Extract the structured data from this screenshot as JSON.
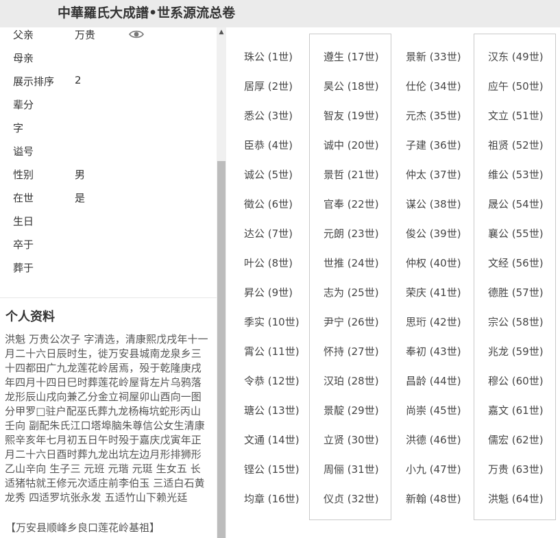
{
  "header": {
    "title": "中華羅氏大成譜•世系源流总卷"
  },
  "fields": [
    {
      "label": "父亲",
      "value": "万贵"
    },
    {
      "label": "母亲",
      "value": ""
    },
    {
      "label": "展示排序",
      "value": "2"
    },
    {
      "label": "辈分",
      "value": ""
    },
    {
      "label": "字",
      "value": ""
    },
    {
      "label": "谥号",
      "value": ""
    },
    {
      "label": "性别",
      "value": "男"
    },
    {
      "label": "在世",
      "value": "是"
    },
    {
      "label": "生日",
      "value": ""
    },
    {
      "label": "卒于",
      "value": ""
    },
    {
      "label": "葬于",
      "value": ""
    }
  ],
  "icons": {
    "eye": "eye-icon",
    "scroll_up": "scroll-up-icon"
  },
  "profile": {
    "heading": "个人资料",
    "text": "洪魁  万贵公次子  字清选，清康熙戊戌年十一月二十六日辰时生，徙万安县城南龙泉乡三十四都田广九龙莲花岭居焉，殁于乾隆庚戌年四月十四日巳时葬莲花岭屋背左片乌鸦落龙形辰山戌向兼乙分金立祠屋卯山酉向一图分甲罗□驻户配巫氏葬九龙杨梅坑蛇形丙山壬向  副配朱氏江口塔埠脑朱尊信公女生清康熙辛亥年七月初五日午时殁于嘉庆戊寅年正月二十六日酉时葬九龙出坑左边月形排狮形乙山辛向  生子三  元班 元瑎 元珽  生女五  长适猪牯就王修元次适庄前李伯玉  三适白石黄龙秀  四适罗坑张永发  五适竹山下赖光廷",
    "grave": "【万安县顺峰乡良口莲花岭基祖】"
  },
  "generations": [
    [
      "珠公 (1世)",
      "居厚 (2世)",
      "悉公 (3世)",
      "臣恭 (4世)",
      "诚公 (5世)",
      "徵公 (6世)",
      "达公 (7世)",
      "叶公 (8世)",
      "昇公 (9世)",
      "季实 (10世)",
      "霄公 (11世)",
      "令恭 (12世)",
      "瑭公 (13世)",
      "文通 (14世)",
      "铿公 (15世)",
      "均章 (16世)"
    ],
    [
      "遵生 (17世)",
      "昊公 (18世)",
      "智友 (19世)",
      "诚中 (20世)",
      "景哲 (21世)",
      "官奉 (22世)",
      "元朗 (23世)",
      "世推 (24世)",
      "志为 (25世)",
      "尹宁 (26世)",
      "怀持 (27世)",
      "汉珀 (28世)",
      "景靛 (29世)",
      "立贤 (30世)",
      "周俪 (31世)",
      "仪贞 (32世)"
    ],
    [
      "景新 (33世)",
      "仕伦 (34世)",
      "元杰 (35世)",
      "子建 (36世)",
      "仲太 (37世)",
      "谋公 (38世)",
      "俊公 (39世)",
      "仲权 (40世)",
      "荣庆 (41世)",
      "思珩 (42世)",
      "奉初 (43世)",
      "昌龄 (44世)",
      "尚崇 (45世)",
      "洪德 (46世)",
      "小九 (47世)",
      "新翰 (48世)"
    ],
    [
      "汉东 (49世)",
      "应午 (50世)",
      "文立 (51世)",
      "祖贤 (52世)",
      "维公 (53世)",
      "晟公 (54世)",
      "襄公 (55世)",
      "文经 (56世)",
      "德胜 (57世)",
      "宗公 (58世)",
      "兆龙 (59世)",
      "穆公 (60世)",
      "嘉文 (61世)",
      "儒宏 (62世)",
      "万贵 (63世)",
      "洪魁 (64世)"
    ]
  ]
}
